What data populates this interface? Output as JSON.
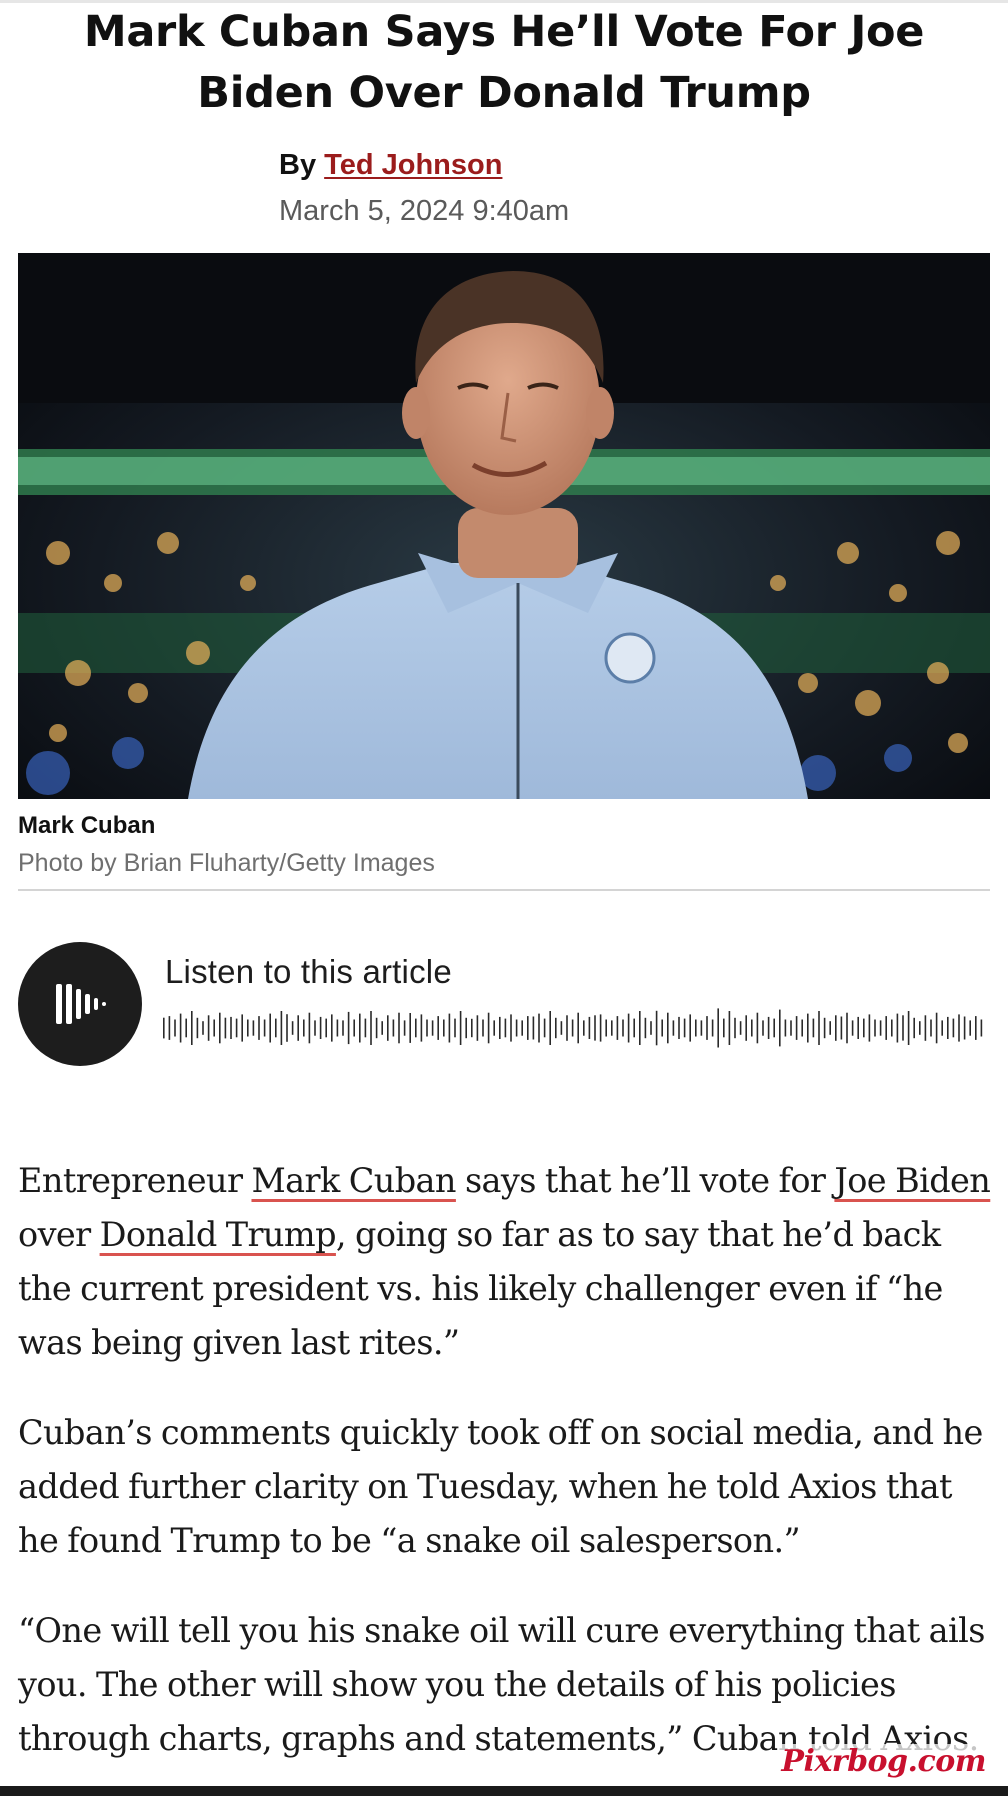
{
  "article": {
    "headline": "Mark Cuban Says He’ll Vote For Joe Biden Over Donald Trump",
    "byline_prefix": "By ",
    "author": "Ted Johnson",
    "date": "March 5, 2024 9:40am"
  },
  "hero_image": {
    "alt": "Mark Cuban",
    "caption": "Mark Cuban",
    "credit": "Photo by Brian Fluharty/Getty Images"
  },
  "audio": {
    "label": "Listen to this article",
    "play_icon": "audio-waveform-icon"
  },
  "body": {
    "p1": {
      "t1": "Entrepreneur ",
      "link1": "Mark Cuban",
      "t2": " says that he’ll vote for ",
      "link2": "Joe Biden",
      "t3": " over ",
      "link3": "Donald Trump",
      "t4": ", going so far as to say that he’d back the current president vs. his likely challenger even if “he was being given last rites.”"
    },
    "p2": "Cuban’s comments quickly took off on social media, and he added further clarity on Tuesday, when he told Axios that he found Trump to be “a snake oil salesperson.”",
    "p3": "“One will tell you his snake oil will cure everything that ails you. The other will show you the details of his policies through charts, graphs and statements,” Cuban told Axios."
  },
  "watermark": "Pixrbog.com",
  "colors": {
    "link": "#9b1c1c",
    "link_underline": "#d9534f",
    "audio_button": "#1d1d1d",
    "watermark": "#c8102e"
  }
}
